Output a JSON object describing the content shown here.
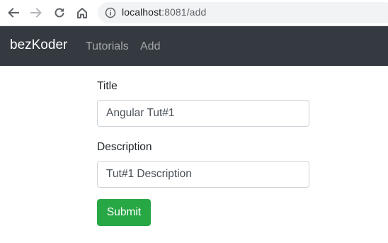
{
  "browser": {
    "url_host": "localhost",
    "url_port_path": ":8081/add",
    "back_icon": "arrow-left-icon",
    "forward_icon": "arrow-right-icon",
    "reload_icon": "reload-icon",
    "home_icon": "home-icon",
    "info_icon": "info-icon"
  },
  "navbar": {
    "brand": "bezKoder",
    "links": [
      "Tutorials",
      "Add"
    ]
  },
  "form": {
    "title_label": "Title",
    "title_value": "Angular Tut#1",
    "description_label": "Description",
    "description_value": "Tut#1 Description",
    "submit_label": "Submit"
  },
  "colors": {
    "navbar_bg": "#343a40",
    "submit_bg": "#28a745"
  }
}
